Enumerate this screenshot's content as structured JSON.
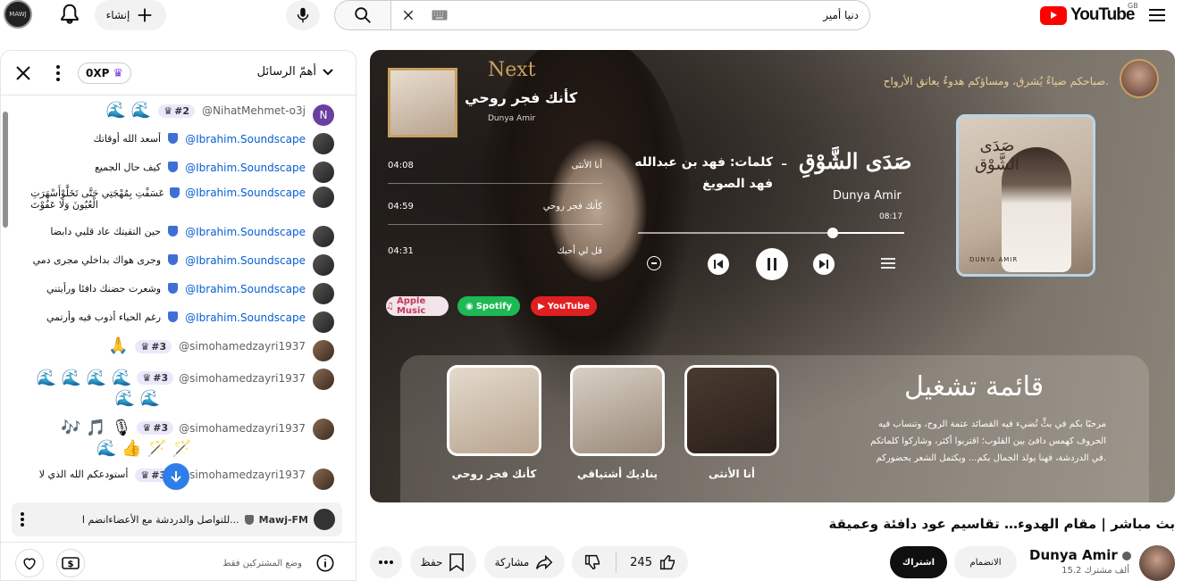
{
  "topbar": {
    "create_label": "إنشاء",
    "search_value": "دنيا أمير",
    "logo_text": "YouTube",
    "region": "GB",
    "avatar_text": "MAWJ"
  },
  "chat": {
    "header_title": "أهمّ الرسائل",
    "xp": "0XP",
    "messages": [
      {
        "author": "@NihatMehmet-o3j",
        "badge": "#2",
        "text": "🌊 🌊",
        "avatar_letter": "N"
      },
      {
        "author": "@Ibrahim.Soundscape",
        "text": "أسعد الله أوقاتك"
      },
      {
        "author": "@Ibrahim.Soundscape",
        "text": "كيف حال الجميع"
      },
      {
        "author": "@Ibrahim.Soundscape",
        "text": "عَسَفْتِ بِمُهْجَتِي حَتَّى تَخَلَّوْأَسْهَرَتِ",
        "text2": "الْعُيُونَ وَلَا عَفُوْتَ"
      },
      {
        "author": "@Ibrahim.Soundscape",
        "text": "حين التقيتك عاد قلبي دابضا"
      },
      {
        "author": "@Ibrahim.Soundscape",
        "text": "وجرى هواك بداخلي مجرى دمي"
      },
      {
        "author": "@Ibrahim.Soundscape",
        "text": "وشعرت حضنك دافئا ورأيتني"
      },
      {
        "author": "@Ibrahim.Soundscape",
        "text": "رغم الحياء أذوب فيه وأرتمي"
      },
      {
        "author": "@simohamedzayri1937",
        "badge": "#3",
        "text": "🙏"
      },
      {
        "author": "@simohamedzayri1937",
        "badge": "#3",
        "text": "🌊 🌊 🌊 🌊",
        "text2": "🌊 🌊"
      },
      {
        "author": "@simohamedzayri1937",
        "badge": "#3",
        "text": "🎶 🎵 🎙",
        "text2": "🌊 👍 🪄 🪄"
      },
      {
        "author": "@simohamedzayri1937",
        "badge": "#3",
        "text": "أستودعكم الله الذي لا"
      }
    ],
    "pinned_author": "Mawj-FM",
    "pinned_text": "للتواصل والدردشة مع الأعضاءانضم ا...",
    "footer_mode": "وضع المشتركين فقط"
  },
  "player": {
    "greeting": "صباحكم ضياءٌ يُشرق، ومساؤكم هدوءٌ يعانق الأرواح.",
    "next_label": "Next",
    "next_title": "كأنك فجر روحي",
    "next_artist": "Dunya Amir",
    "song_title": "صَدَى الشَّوْقِ",
    "lyrics_label": "كلمات: فهد بن عبدالله",
    "lyrics_label2": "فهد الصويغ",
    "artist": "Dunya Amir",
    "time": "08:17",
    "progress": 0.27,
    "tracks": [
      {
        "name": "أنا الأنثى",
        "time": "04:08"
      },
      {
        "name": "كأنك فجر روحي",
        "time": "04:59"
      },
      {
        "name": "قل لي أحبك",
        "time": "04:31"
      }
    ],
    "platforms": [
      "Apple Music",
      "Spotify",
      "YouTube"
    ],
    "playlist_heading": "قائمة تشغيل",
    "playlist_desc": [
      "مرحبًا بكم في بثٍّ تُضيء فيه القصائد عتمة الروح، وتنساب فيه",
      "الحروف كهمس دافئ بين القلوب؛ اقتربوا أكثر، وشاركوا كلماتكم",
      "في الدردشة، فهنا يولد الجمال بكم... ويكتمل الشعر بحضوركم."
    ],
    "playlist_items": [
      "أنا الأنثى",
      "يناديك أشتياقي",
      "كأنك فجر روحي"
    ],
    "cover_title": "صَدَى الشَّوْق",
    "cover_artist": "DUNYA AMIR"
  },
  "video": {
    "title": "بث مباشر | مقام الهدوء… تقاسيم عود دافئة وعميقة",
    "channel": "Dunya Amir",
    "subscribers": "15.2 ألف مشترك",
    "join_label": "الانضمام",
    "subscribe_label": "اشتراك",
    "likes": "245",
    "share_label": "مشاركة",
    "save_label": "حفظ"
  },
  "colors": {
    "link": "#065fd4",
    "brand": "#ff0000",
    "badge_bg": "#ece7fb"
  }
}
